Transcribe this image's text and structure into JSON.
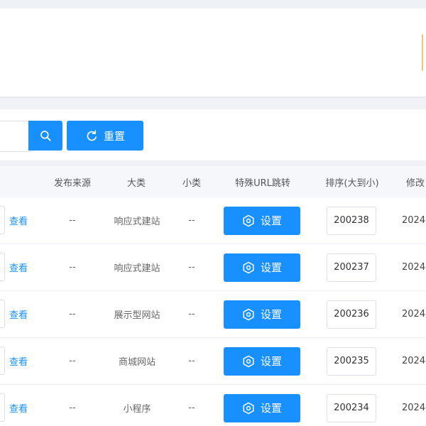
{
  "toolbar": {
    "search_placeholder": "",
    "reset_label": "重置",
    "icons": {
      "search": "search-icon",
      "reset": "refresh-icon"
    }
  },
  "table": {
    "columns": {
      "publish_source": "发布来源",
      "major_category": "大类",
      "minor_category": "小类",
      "special_url": "特殊URL跳转",
      "sort": "排序(大到小)",
      "modified_partial": "修改"
    },
    "rows": [
      {
        "view": "查看",
        "publish_source": "--",
        "major_category": "响应式建站",
        "minor_category": "--",
        "settings": "设置",
        "sort": "200238",
        "modified_partial": "2024-"
      },
      {
        "view": "查看",
        "publish_source": "--",
        "major_category": "响应式建站",
        "minor_category": "--",
        "settings": "设置",
        "sort": "200237",
        "modified_partial": "2024-"
      },
      {
        "view": "查看",
        "publish_source": "--",
        "major_category": "展示型网站",
        "minor_category": "--",
        "settings": "设置",
        "sort": "200236",
        "modified_partial": "2024-"
      },
      {
        "view": "查看",
        "publish_source": "--",
        "major_category": "商城网站",
        "minor_category": "--",
        "settings": "设置",
        "sort": "200235",
        "modified_partial": "2024-"
      },
      {
        "view": "查看",
        "publish_source": "--",
        "major_category": "小程序",
        "minor_category": "--",
        "settings": "设置",
        "sort": "200234",
        "modified_partial": "2024-"
      }
    ]
  },
  "colors": {
    "primary": "#1890ff",
    "header_bg": "#f5f7fa",
    "page_bg": "#f0f2f5"
  }
}
